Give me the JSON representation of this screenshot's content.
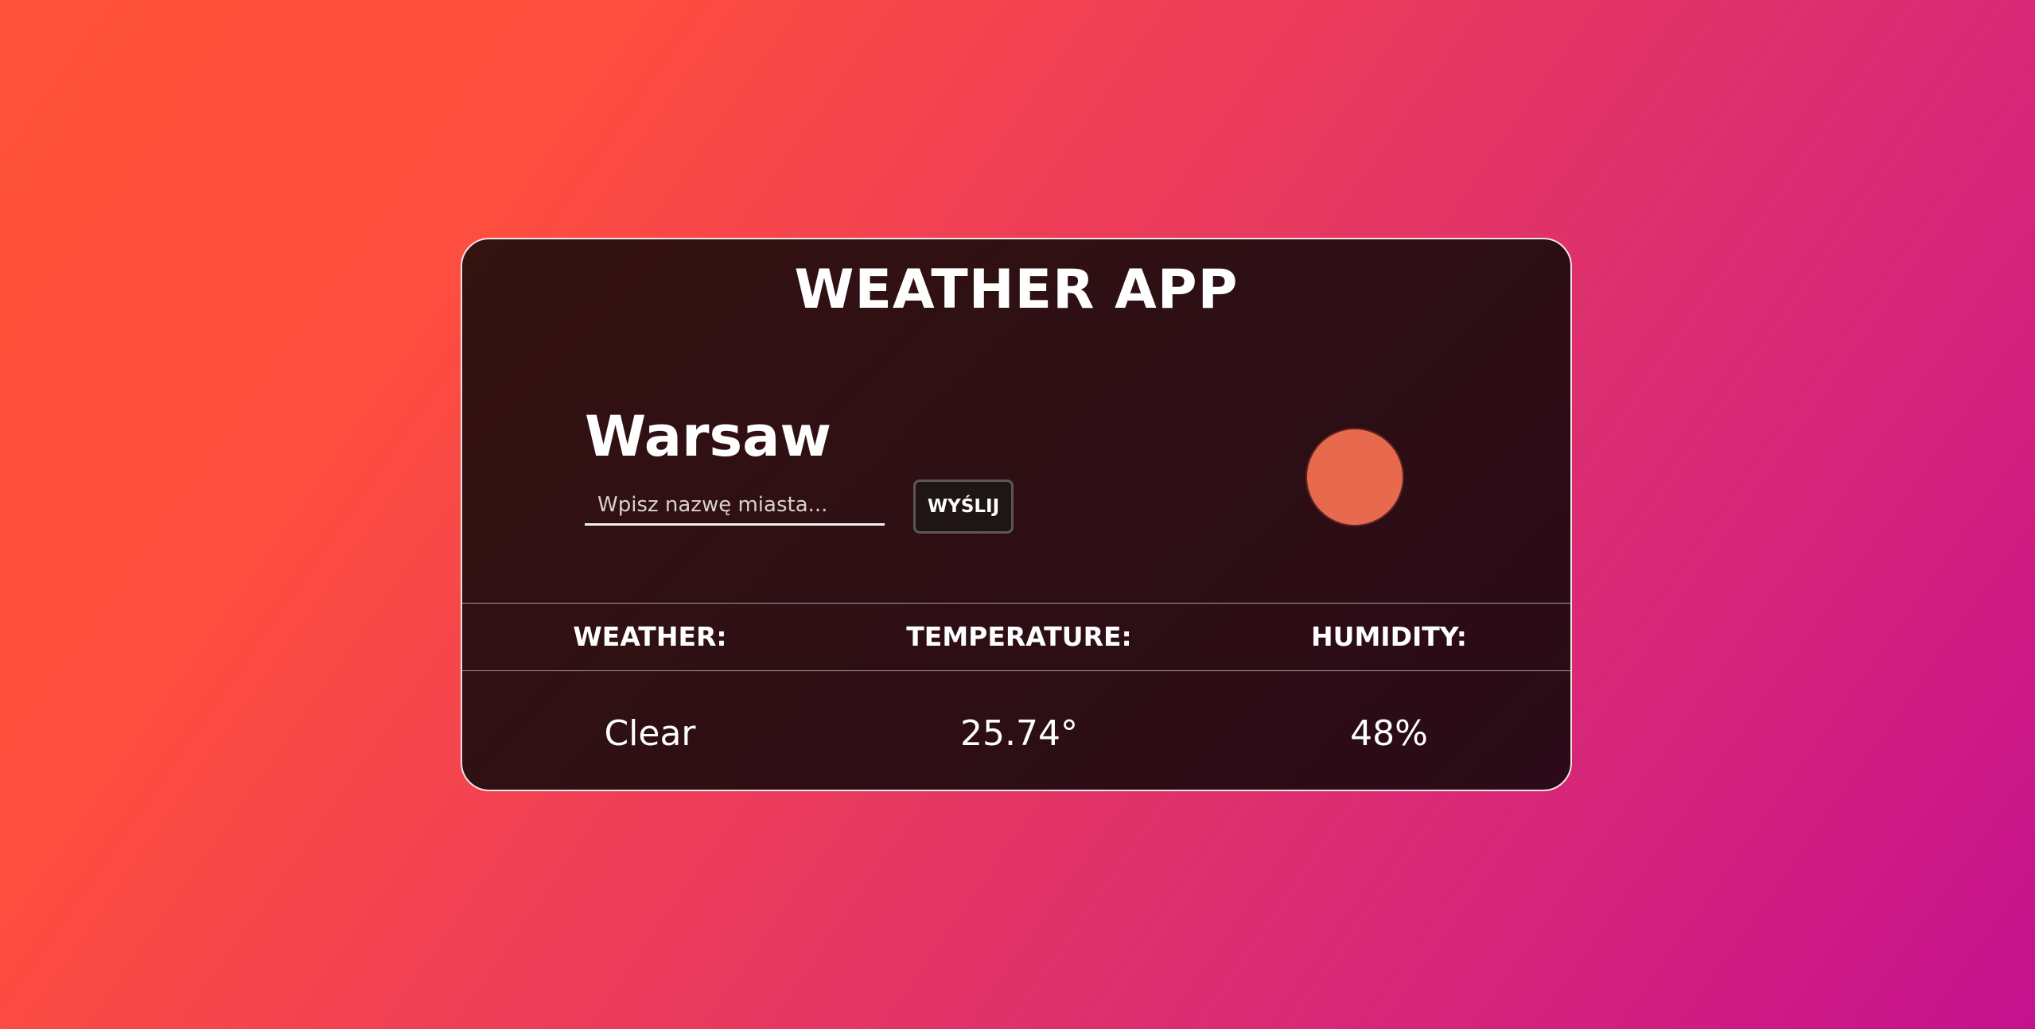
{
  "app": {
    "title": "WEATHER APP"
  },
  "location": {
    "city": "Warsaw"
  },
  "search": {
    "placeholder": "Wpisz nazwę miasta...",
    "value": "",
    "button_label": "WYŚLIJ"
  },
  "condition_icon": {
    "name": "sun-icon",
    "color": "#e86a4e"
  },
  "stats": {
    "headers": [
      "WEATHER:",
      "TEMPERATURE:",
      "HUMIDITY:"
    ],
    "values": [
      "Clear",
      "25.74°",
      "48%"
    ]
  },
  "colors": {
    "card_background": "#2e0f14",
    "card_border": "#f3e3e3",
    "gradient_start": "#ff5238",
    "gradient_end": "#c5118d"
  }
}
